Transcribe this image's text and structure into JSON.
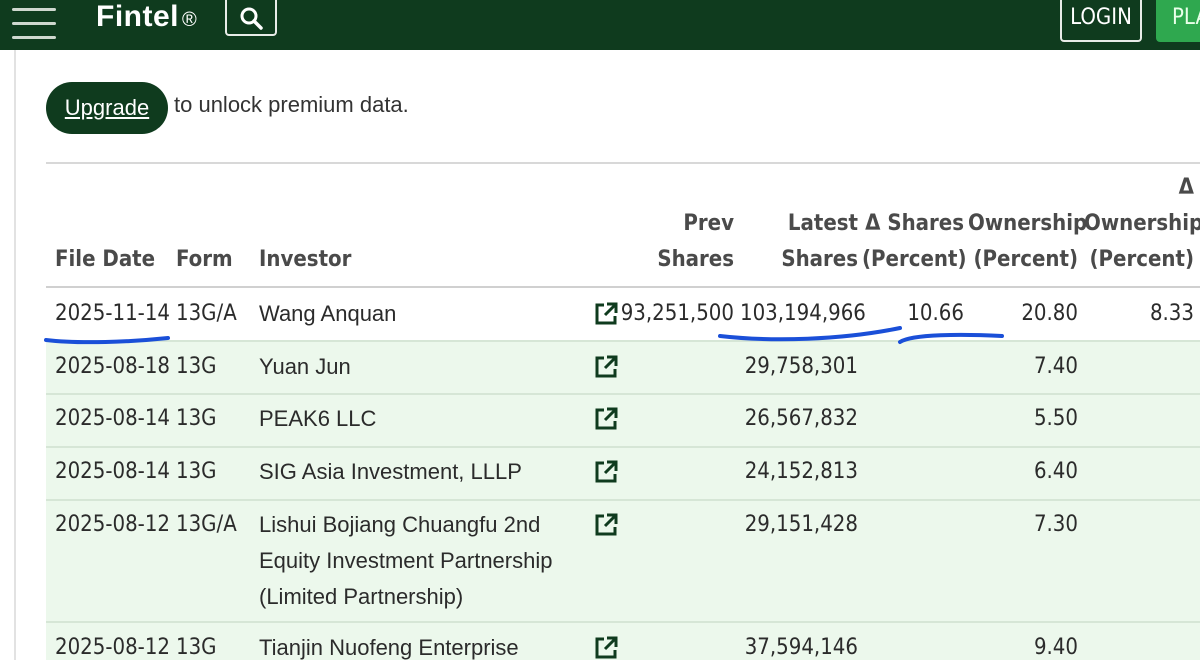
{
  "header": {
    "brand": "Fintel",
    "reg_mark": "®",
    "login_label": "LOGIN",
    "plans_label": "PLA"
  },
  "upgrade": {
    "button_label": "Upgrade",
    "text": "to unlock premium data."
  },
  "table": {
    "headers": {
      "file_date": "File Date",
      "form": "Form",
      "investor": "Investor",
      "prev_shares_1": "Prev",
      "prev_shares_2": "Shares",
      "latest_shares_1": "Latest",
      "latest_shares_2": "Shares",
      "delta_shares_1": "Δ Shares",
      "delta_shares_2": "(Percent)",
      "ownership_1": "Ownership",
      "ownership_2": "(Percent)",
      "delta_ownership_0": "Δ",
      "delta_ownership_1": "Ownership",
      "delta_ownership_2": "(Percent)"
    },
    "rows": [
      {
        "file_date": "2025-11-14",
        "form": "13G/A",
        "investor_1": "Wang Anquan",
        "investor_2": "",
        "investor_3": "",
        "prev_shares": "93,251,500",
        "latest_shares": "103,194,966",
        "delta_shares": "10.66",
        "ownership": "20.80",
        "delta_ownership": "8.33"
      },
      {
        "file_date": "2025-08-18",
        "form": "13G",
        "investor_1": "Yuan Jun",
        "investor_2": "",
        "investor_3": "",
        "prev_shares": "",
        "latest_shares": "29,758,301",
        "delta_shares": "",
        "ownership": "7.40",
        "delta_ownership": ""
      },
      {
        "file_date": "2025-08-14",
        "form": "13G",
        "investor_1": "PEAK6 LLC",
        "investor_2": "",
        "investor_3": "",
        "prev_shares": "",
        "latest_shares": "26,567,832",
        "delta_shares": "",
        "ownership": "5.50",
        "delta_ownership": ""
      },
      {
        "file_date": "2025-08-14",
        "form": "13G",
        "investor_1": "SIG Asia Investment, LLLP",
        "investor_2": "",
        "investor_3": "",
        "prev_shares": "",
        "latest_shares": "24,152,813",
        "delta_shares": "",
        "ownership": "6.40",
        "delta_ownership": ""
      },
      {
        "file_date": "2025-08-12",
        "form": "13G/A",
        "investor_1": "Lishui Bojiang Chuangfu 2nd",
        "investor_2": "Equity Investment Partnership",
        "investor_3": "(Limited Partnership)",
        "prev_shares": "",
        "latest_shares": "29,151,428",
        "delta_shares": "",
        "ownership": "7.30",
        "delta_ownership": ""
      },
      {
        "file_date": "2025-08-12",
        "form": "13G",
        "investor_1": "Tianjin Nuofeng Enterprise",
        "investor_2": "",
        "investor_3": "",
        "prev_shares": "",
        "latest_shares": "37,594,146",
        "delta_shares": "",
        "ownership": "9.40",
        "delta_ownership": ""
      }
    ]
  },
  "icons": {
    "menu": "hamburger-menu-icon",
    "search": "search-icon",
    "external": "external-link-icon"
  },
  "colors": {
    "header_bg": "#0f3b1e",
    "accent_green": "#2fa84f",
    "row_alt_bg": "#ecf8ec",
    "annotation_blue": "#1a4fd8"
  }
}
